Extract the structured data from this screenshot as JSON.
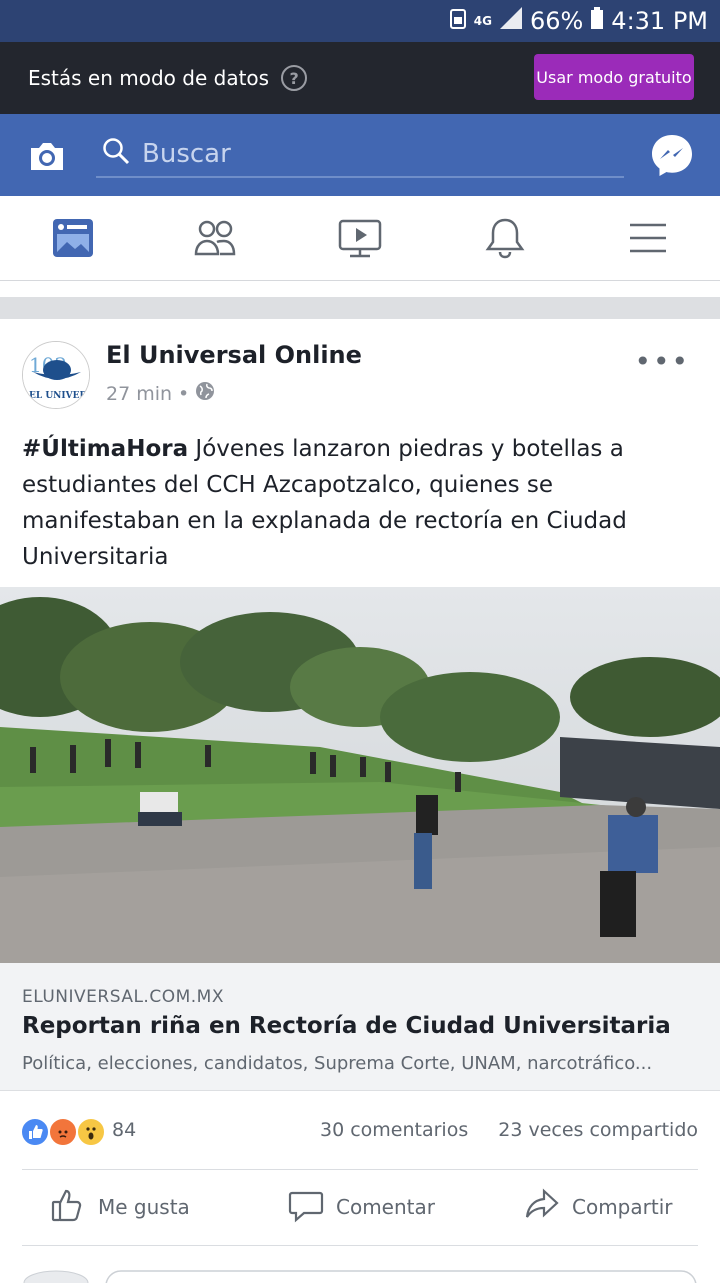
{
  "status_bar": {
    "network": "4G",
    "battery": "66%",
    "time": "4:31 PM"
  },
  "data_mode_banner": {
    "text": "Estás en modo de datos",
    "free_mode_button": "Usar modo gratuito",
    "button_color": "#9b2bb9"
  },
  "search_bar": {
    "placeholder": "Buscar",
    "brand_color": "#4267b2"
  },
  "nav": {
    "items": [
      "news-feed-icon",
      "friends-icon",
      "watch-icon",
      "notifications-icon",
      "menu-icon"
    ],
    "active": "news-feed-icon"
  },
  "post": {
    "page_name": "El Universal Online",
    "time": "27 min",
    "hashtag": "#ÚltimaHora",
    "body": " Jóvenes lanzaron piedras y botellas a estudiantes del CCH Azcapotzalco, quienes se manifestaban en la explanada de rectoría en Ciudad Universitaria",
    "link": {
      "domain": "ELUNIVERSAL.COM.MX",
      "title": "Reportan riña en Rectoría de Ciudad Universitaria",
      "description": "Política, elecciones, candidatos, Suprema Corte, UNAM, narcotráfico..."
    },
    "reactions": {
      "count": "84",
      "types": [
        "like",
        "angry",
        "wow"
      ]
    },
    "comments": "30 comentarios",
    "shares": "23 veces compartido",
    "actions": {
      "like": "Me gusta",
      "comment": "Comentar",
      "share": "Compartir"
    }
  }
}
